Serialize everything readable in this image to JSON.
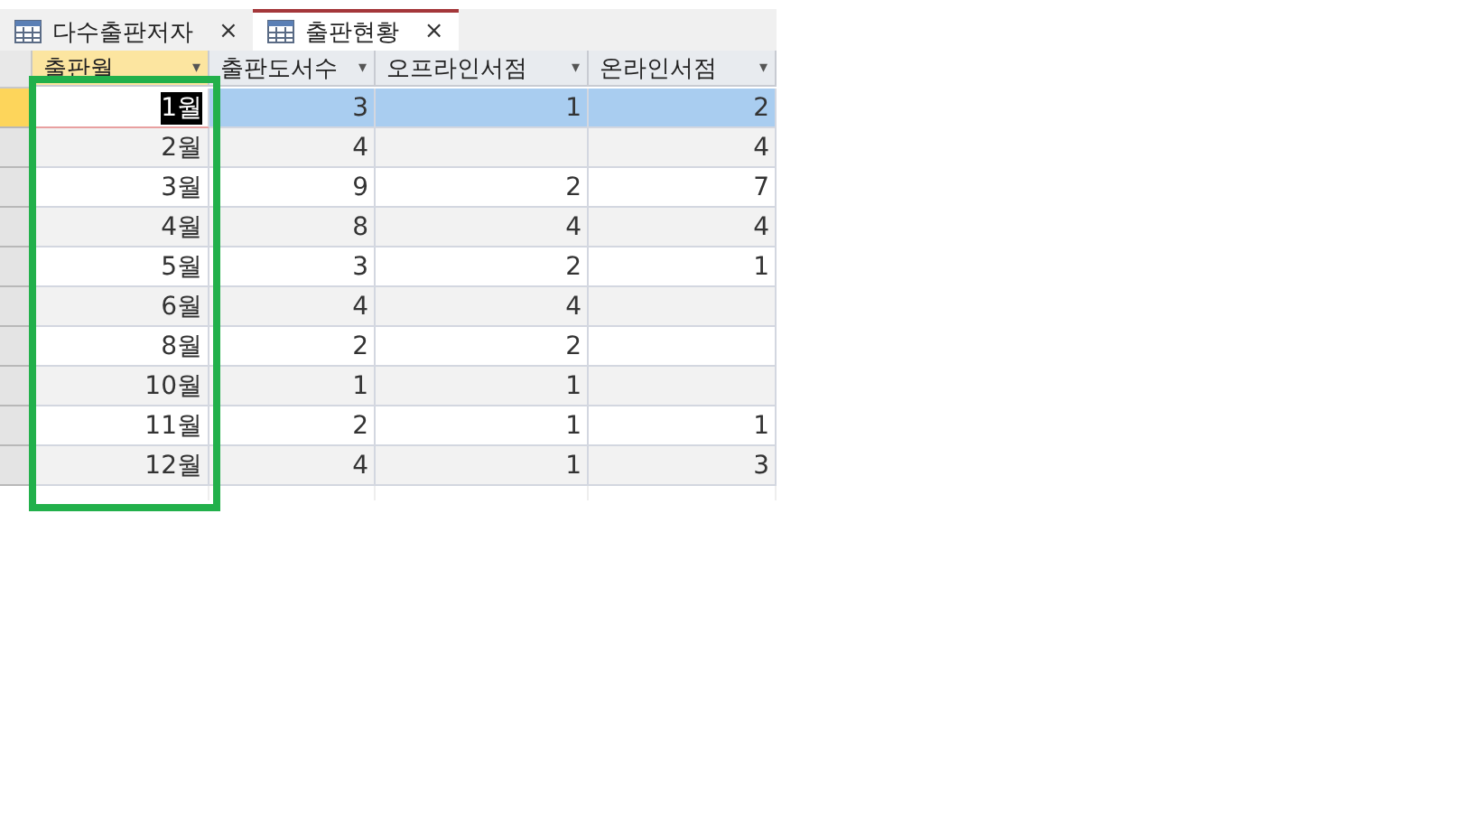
{
  "tabs": [
    {
      "label": "다수출판저자",
      "close": "×",
      "selected": false
    },
    {
      "label": "출판현황",
      "close": "×",
      "selected": true
    }
  ],
  "table": {
    "columns": [
      {
        "label": "출판월",
        "arrow": "▾",
        "selected": true
      },
      {
        "label": "출판도서수",
        "arrow": "▾",
        "selected": false
      },
      {
        "label": "오프라인서점",
        "arrow": "▾",
        "selected": false
      },
      {
        "label": "온라인서점",
        "arrow": "▾",
        "selected": false
      }
    ],
    "rows": [
      {
        "selected": true,
        "cells": [
          "1월",
          "3",
          "1",
          "2"
        ]
      },
      {
        "selected": false,
        "cells": [
          "2월",
          "4",
          "",
          "4"
        ]
      },
      {
        "selected": false,
        "cells": [
          "3월",
          "9",
          "2",
          "7"
        ]
      },
      {
        "selected": false,
        "cells": [
          "4월",
          "8",
          "4",
          "4"
        ]
      },
      {
        "selected": false,
        "cells": [
          "5월",
          "3",
          "2",
          "1"
        ]
      },
      {
        "selected": false,
        "cells": [
          "6월",
          "4",
          "4",
          ""
        ]
      },
      {
        "selected": false,
        "cells": [
          "8월",
          "2",
          "2",
          ""
        ]
      },
      {
        "selected": false,
        "cells": [
          "10월",
          "1",
          "1",
          ""
        ]
      },
      {
        "selected": false,
        "cells": [
          "11월",
          "2",
          "1",
          "1"
        ]
      },
      {
        "selected": false,
        "cells": [
          "12월",
          "4",
          "1",
          "3"
        ]
      }
    ]
  }
}
